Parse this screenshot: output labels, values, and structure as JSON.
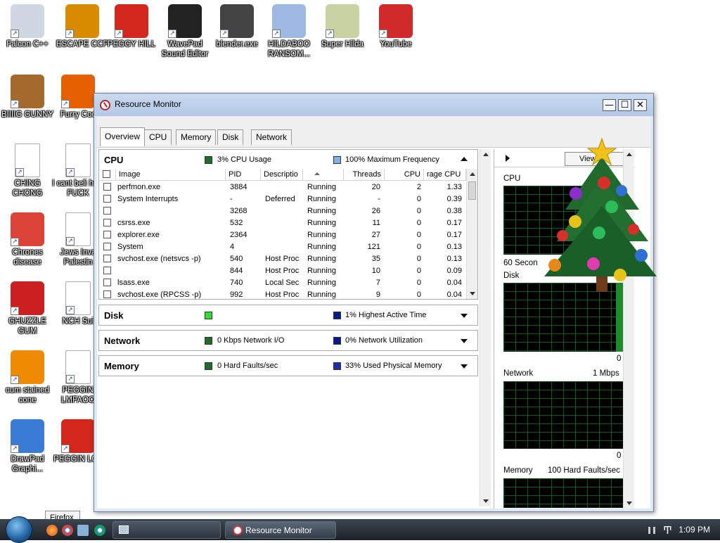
{
  "desktop": {
    "icons": [
      {
        "label": "Falcon C++",
        "icon": "recycle-bin-icon",
        "color": "#cfd8e2"
      },
      {
        "label": "ESCAPE CCP",
        "icon": "mahjong-icon",
        "color": "#d98b00"
      },
      {
        "label": "PEGGY HILL",
        "icon": "p-logo-icon",
        "color": "#d2271a"
      },
      {
        "label": "WavePad Sound Editor",
        "icon": "waveform-icon",
        "color": "#222222"
      },
      {
        "label": "blender.exe",
        "icon": "blender-icon",
        "color": "#444444"
      },
      {
        "label": "HILDABOO RANSOM...",
        "icon": "letter-icon",
        "color": "#9db8e3"
      },
      {
        "label": "Super Hilda",
        "icon": "pixel-cat-icon",
        "color": "#c7d3a0"
      },
      {
        "label": "YouTube",
        "icon": "angry-bird-icon",
        "color": "#d02a2a"
      },
      {
        "label": "BIIIIG GUNNY",
        "icon": "money-bag-icon",
        "color": "#a36a2b"
      },
      {
        "label": "Furry Coc",
        "icon": "firefox-icon",
        "color": "#e66000"
      },
      {
        "label": "CHING CHONG",
        "icon": "document-icon",
        "color": "#ffffff"
      },
      {
        "label": "I cant beli how FUCK",
        "icon": "document-icon",
        "color": "#ffffff"
      },
      {
        "label": "Chrones disease",
        "icon": "chrome-icon",
        "color": "#db4437"
      },
      {
        "label": "Jews Inva Palestin",
        "icon": "document-icon",
        "color": "#ffffff"
      },
      {
        "label": "GHUZZLE GUM",
        "icon": "red-fuzzball-icon",
        "color": "#cc1f1f"
      },
      {
        "label": "NCH Sui",
        "icon": "nch-icon",
        "color": "#ffffff"
      },
      {
        "label": "cum stained cone",
        "icon": "vlc-cone-icon",
        "color": "#f08a00"
      },
      {
        "label": "PEGGIN LMFAOO",
        "icon": "document-icon",
        "color": "#ffffff"
      },
      {
        "label": "DrawPad Graphi...",
        "icon": "drawpad-icon",
        "color": "#3a7bd5"
      },
      {
        "label": "PEGGIN LOL",
        "icon": "p-logo-icon",
        "color": "#d2271a"
      }
    ]
  },
  "window": {
    "title": "Resource Monitor",
    "minimize": "—",
    "maximize": "☐",
    "close": "✕",
    "tabs": [
      "Overview",
      "CPU",
      "Memory",
      "Disk",
      "Network"
    ],
    "active_tab": "Overview"
  },
  "cpu": {
    "title": "CPU",
    "usage_text": "3% CPU Usage",
    "freq_text": "100% Maximum Frequency",
    "usage_color": "#1f6b2a",
    "freq_color": "#7fb2e6",
    "columns": [
      "Image",
      "PID",
      "Descriptio",
      "",
      "Threads",
      "CPU",
      "rage CPU"
    ],
    "rows": [
      {
        "image": "perfmon.exe",
        "pid": "3884",
        "desc": "",
        "status": "Running",
        "threads": "20",
        "cpu": "2",
        "avg": "1.33"
      },
      {
        "image": "System Interrupts",
        "pid": "-",
        "desc": "Deferred",
        "status": "Running",
        "threads": "-",
        "cpu": "0",
        "avg": "0.39"
      },
      {
        "image": "",
        "pid": "3268",
        "desc": "",
        "status": "Running",
        "threads": "26",
        "cpu": "0",
        "avg": "0.38"
      },
      {
        "image": "csrss.exe",
        "pid": "532",
        "desc": "",
        "status": "Running",
        "threads": "11",
        "cpu": "0",
        "avg": "0.17"
      },
      {
        "image": "explorer.exe",
        "pid": "2364",
        "desc": "",
        "status": "Running",
        "threads": "27",
        "cpu": "0",
        "avg": "0.17"
      },
      {
        "image": "System",
        "pid": "4",
        "desc": "",
        "status": "Running",
        "threads": "121",
        "cpu": "0",
        "avg": "0.13"
      },
      {
        "image": "svchost.exe (netsvcs -p)",
        "pid": "540",
        "desc": "Host Proc",
        "status": "Running",
        "threads": "35",
        "cpu": "0",
        "avg": "0.13"
      },
      {
        "image": "",
        "pid": "844",
        "desc": "Host Proc",
        "status": "Running",
        "threads": "10",
        "cpu": "0",
        "avg": "0.09"
      },
      {
        "image": "lsass.exe",
        "pid": "740",
        "desc": "Local Sec",
        "status": "Running",
        "threads": "7",
        "cpu": "0",
        "avg": "0.04"
      },
      {
        "image": "svchost.exe (RPCSS -p)",
        "pid": "992",
        "desc": "Host Proc",
        "status": "Running",
        "threads": "9",
        "cpu": "0",
        "avg": "0.04"
      }
    ]
  },
  "disk": {
    "title": "Disk",
    "left_color": "#33dd33",
    "right_text": "1% Highest Active Time",
    "right_color": "#0b1a8a"
  },
  "network": {
    "title": "Network",
    "left_text": "0 Kbps Network I/O",
    "left_color": "#1f6b2a",
    "right_text": "0% Network Utilization",
    "right_color": "#0b1a8a"
  },
  "memory": {
    "title": "Memory",
    "left_text": "0 Hard Faults/sec",
    "left_color": "#1f6b2a",
    "right_text": "33% Used Physical Memory",
    "right_color": "#1d2fa8"
  },
  "right_pane": {
    "views_label": "Views",
    "cpu_label": "CPU",
    "cpu_time_label": "60 Secon",
    "disk_label": "Disk",
    "disk_zero": "0",
    "network_label": "Network",
    "network_scale": "1 Mbps",
    "network_zero": "0",
    "memory_label": "Memory",
    "memory_scale": "100 Hard Faults/sec"
  },
  "taskbar": {
    "tooltip": "Firefox",
    "task_label": "Resource Monitor",
    "clock": "1:09 PM"
  }
}
